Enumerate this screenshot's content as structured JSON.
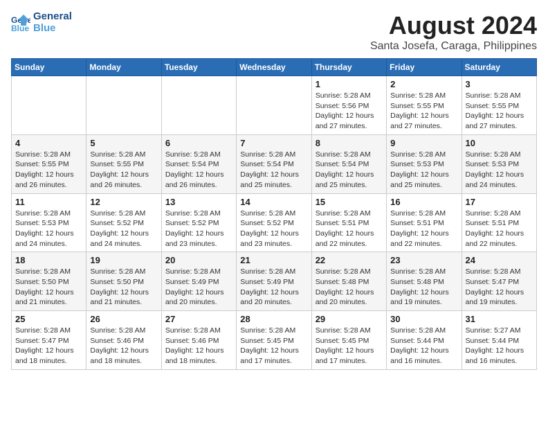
{
  "logo": {
    "text1": "General",
    "text2": "Blue"
  },
  "title": "August 2024",
  "subtitle": "Santa Josefa, Caraga, Philippines",
  "headers": [
    "Sunday",
    "Monday",
    "Tuesday",
    "Wednesday",
    "Thursday",
    "Friday",
    "Saturday"
  ],
  "weeks": [
    [
      {
        "day": "",
        "info": ""
      },
      {
        "day": "",
        "info": ""
      },
      {
        "day": "",
        "info": ""
      },
      {
        "day": "",
        "info": ""
      },
      {
        "day": "1",
        "info": "Sunrise: 5:28 AM\nSunset: 5:56 PM\nDaylight: 12 hours\nand 27 minutes."
      },
      {
        "day": "2",
        "info": "Sunrise: 5:28 AM\nSunset: 5:55 PM\nDaylight: 12 hours\nand 27 minutes."
      },
      {
        "day": "3",
        "info": "Sunrise: 5:28 AM\nSunset: 5:55 PM\nDaylight: 12 hours\nand 27 minutes."
      }
    ],
    [
      {
        "day": "4",
        "info": "Sunrise: 5:28 AM\nSunset: 5:55 PM\nDaylight: 12 hours\nand 26 minutes."
      },
      {
        "day": "5",
        "info": "Sunrise: 5:28 AM\nSunset: 5:55 PM\nDaylight: 12 hours\nand 26 minutes."
      },
      {
        "day": "6",
        "info": "Sunrise: 5:28 AM\nSunset: 5:54 PM\nDaylight: 12 hours\nand 26 minutes."
      },
      {
        "day": "7",
        "info": "Sunrise: 5:28 AM\nSunset: 5:54 PM\nDaylight: 12 hours\nand 25 minutes."
      },
      {
        "day": "8",
        "info": "Sunrise: 5:28 AM\nSunset: 5:54 PM\nDaylight: 12 hours\nand 25 minutes."
      },
      {
        "day": "9",
        "info": "Sunrise: 5:28 AM\nSunset: 5:53 PM\nDaylight: 12 hours\nand 25 minutes."
      },
      {
        "day": "10",
        "info": "Sunrise: 5:28 AM\nSunset: 5:53 PM\nDaylight: 12 hours\nand 24 minutes."
      }
    ],
    [
      {
        "day": "11",
        "info": "Sunrise: 5:28 AM\nSunset: 5:53 PM\nDaylight: 12 hours\nand 24 minutes."
      },
      {
        "day": "12",
        "info": "Sunrise: 5:28 AM\nSunset: 5:52 PM\nDaylight: 12 hours\nand 24 minutes."
      },
      {
        "day": "13",
        "info": "Sunrise: 5:28 AM\nSunset: 5:52 PM\nDaylight: 12 hours\nand 23 minutes."
      },
      {
        "day": "14",
        "info": "Sunrise: 5:28 AM\nSunset: 5:52 PM\nDaylight: 12 hours\nand 23 minutes."
      },
      {
        "day": "15",
        "info": "Sunrise: 5:28 AM\nSunset: 5:51 PM\nDaylight: 12 hours\nand 22 minutes."
      },
      {
        "day": "16",
        "info": "Sunrise: 5:28 AM\nSunset: 5:51 PM\nDaylight: 12 hours\nand 22 minutes."
      },
      {
        "day": "17",
        "info": "Sunrise: 5:28 AM\nSunset: 5:51 PM\nDaylight: 12 hours\nand 22 minutes."
      }
    ],
    [
      {
        "day": "18",
        "info": "Sunrise: 5:28 AM\nSunset: 5:50 PM\nDaylight: 12 hours\nand 21 minutes."
      },
      {
        "day": "19",
        "info": "Sunrise: 5:28 AM\nSunset: 5:50 PM\nDaylight: 12 hours\nand 21 minutes."
      },
      {
        "day": "20",
        "info": "Sunrise: 5:28 AM\nSunset: 5:49 PM\nDaylight: 12 hours\nand 20 minutes."
      },
      {
        "day": "21",
        "info": "Sunrise: 5:28 AM\nSunset: 5:49 PM\nDaylight: 12 hours\nand 20 minutes."
      },
      {
        "day": "22",
        "info": "Sunrise: 5:28 AM\nSunset: 5:48 PM\nDaylight: 12 hours\nand 20 minutes."
      },
      {
        "day": "23",
        "info": "Sunrise: 5:28 AM\nSunset: 5:48 PM\nDaylight: 12 hours\nand 19 minutes."
      },
      {
        "day": "24",
        "info": "Sunrise: 5:28 AM\nSunset: 5:47 PM\nDaylight: 12 hours\nand 19 minutes."
      }
    ],
    [
      {
        "day": "25",
        "info": "Sunrise: 5:28 AM\nSunset: 5:47 PM\nDaylight: 12 hours\nand 18 minutes."
      },
      {
        "day": "26",
        "info": "Sunrise: 5:28 AM\nSunset: 5:46 PM\nDaylight: 12 hours\nand 18 minutes."
      },
      {
        "day": "27",
        "info": "Sunrise: 5:28 AM\nSunset: 5:46 PM\nDaylight: 12 hours\nand 18 minutes."
      },
      {
        "day": "28",
        "info": "Sunrise: 5:28 AM\nSunset: 5:45 PM\nDaylight: 12 hours\nand 17 minutes."
      },
      {
        "day": "29",
        "info": "Sunrise: 5:28 AM\nSunset: 5:45 PM\nDaylight: 12 hours\nand 17 minutes."
      },
      {
        "day": "30",
        "info": "Sunrise: 5:28 AM\nSunset: 5:44 PM\nDaylight: 12 hours\nand 16 minutes."
      },
      {
        "day": "31",
        "info": "Sunrise: 5:27 AM\nSunset: 5:44 PM\nDaylight: 12 hours\nand 16 minutes."
      }
    ]
  ]
}
